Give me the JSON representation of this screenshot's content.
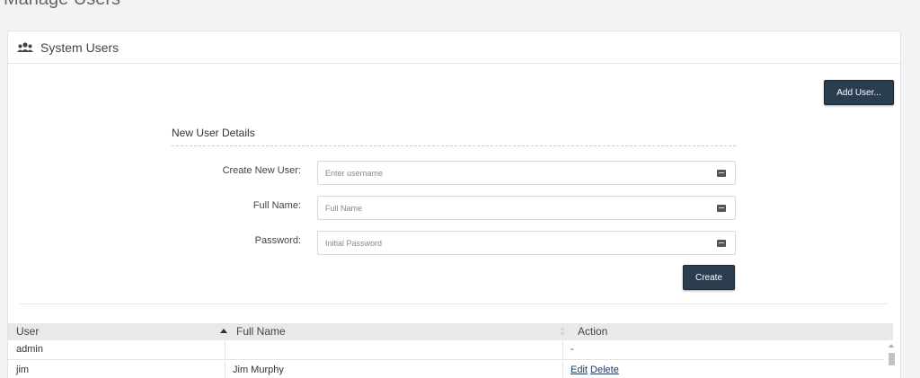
{
  "page": {
    "title": "Manage Users"
  },
  "panel": {
    "title": "System Users",
    "icon": "users-icon"
  },
  "toolbar": {
    "add_user_label": "Add User..."
  },
  "form": {
    "section_title": "New User Details",
    "fields": [
      {
        "label": "Create New User:",
        "placeholder": "Enter username",
        "value": ""
      },
      {
        "label": "Full Name:",
        "placeholder": "Full Name",
        "value": ""
      },
      {
        "label": "Password:",
        "placeholder": "Initial Password",
        "value": ""
      }
    ],
    "create_label": "Create"
  },
  "table": {
    "columns": [
      "User",
      "Full Name",
      "Action"
    ],
    "rows": [
      {
        "user": "admin",
        "full_name": "",
        "action": "-"
      },
      {
        "user": "jim",
        "full_name": "Jim Murphy",
        "edit": "Edit",
        "delete": "Delete"
      }
    ]
  },
  "colors": {
    "button": "#2b3e50",
    "link": "#1f3b63"
  }
}
